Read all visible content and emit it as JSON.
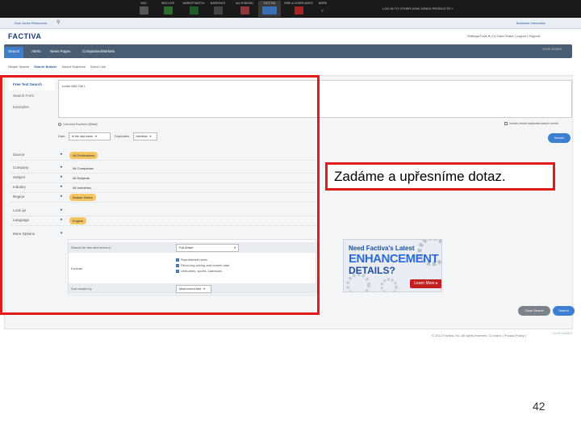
{
  "topbar": {
    "properties": [
      {
        "label": "WSJ"
      },
      {
        "label": "WSJ LIVE"
      },
      {
        "label": "MARKETWATCH"
      },
      {
        "label": "BARRON'S"
      },
      {
        "label": "ALLTHINGSD"
      },
      {
        "label": "FACTIVA"
      },
      {
        "label": "RISK & COMPLIANCE"
      },
      {
        "label": "MORE"
      }
    ],
    "login_message": "LOG IN TO OTHER DOW JONES PRODUCTS »"
  },
  "subbar": {
    "left_link": "Dow Jones Resources",
    "right_link": "Business Interactive"
  },
  "header": {
    "logo": "FACTIVA",
    "user_links": "Settings/Tools ▾ | DJ Data Share | Logout | Support"
  },
  "nav": {
    "tabs": [
      "Search",
      "Alerts",
      "News Pages",
      "Companies/Markets"
    ],
    "brand": "DOW JONES"
  },
  "secondary_nav": [
    "Simple Search",
    "Search Builder",
    "Saved Searches",
    "Direct Link"
  ],
  "builder": {
    "left_tabs": [
      "Free Text Search",
      "Search Form",
      "Examples"
    ],
    "free_text_value": "Learn  IMG  Ctrl  l  ",
    "concept_explorer": "Concept Explorer [Beta]",
    "include_label": "Include media duplicated search media",
    "date_label": "Date",
    "date_value": "In the last week",
    "duplicates_label": "Duplicates",
    "duplicates_value": "identical",
    "search_button": "Search"
  },
  "facets": [
    {
      "label": "Source",
      "value": "All Publications",
      "chip": true
    },
    {
      "label": "Company",
      "value": "All Companies",
      "chip": false
    },
    {
      "label": "Subject",
      "value": "All Subjects",
      "chip": false
    },
    {
      "label": "Industry",
      "value": "All Industries",
      "chip": false
    },
    {
      "label": "Region",
      "value": "Balkan States",
      "chip": true
    },
    {
      "label": "Look up",
      "value": "",
      "chip": false
    },
    {
      "label": "Language",
      "value": "English",
      "chip": true
    },
    {
      "label": "More Options",
      "value": "",
      "chip": false
    }
  ],
  "options": {
    "search_for_label": "Search for free-text terms in",
    "search_for_value": "Full Article",
    "exclude_label": "Exclude",
    "exclude_items": [
      "Republished news",
      "Recurring pricing and market data",
      "Obituaries, sports, calendars"
    ],
    "sort_label": "Sort results by",
    "sort_value": "Most recent first"
  },
  "actions": {
    "clear": "Clear Search",
    "search": "Search"
  },
  "callout": "Zadáme a upřesníme dotaz.",
  "ad": {
    "line1": "Need Factiva's Latest",
    "line2": "ENHANCEMENT",
    "line3": "DETAILS?",
    "button": "Learn More ▸"
  },
  "footer": "© 2012 Factiva, Inc. All rights reserved.  DJ Index | Privacy Policy |",
  "page_number": "42",
  "colors": {
    "highlight": "#e21a1a",
    "nav": "#4a5e73",
    "accent": "#3d7fd1",
    "chip": "#f4c560"
  }
}
